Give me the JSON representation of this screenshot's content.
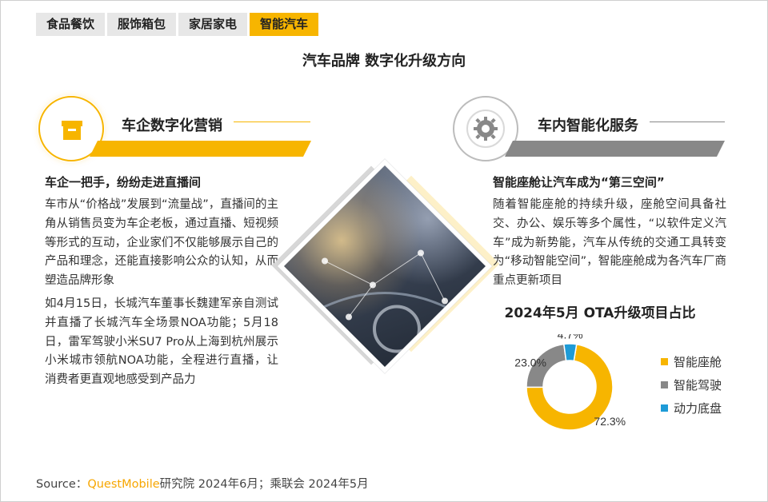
{
  "tabs": [
    {
      "label": "食品餐饮",
      "active": false
    },
    {
      "label": "服饰箱包",
      "active": false
    },
    {
      "label": "家居家电",
      "active": false
    },
    {
      "label": "智能汽车",
      "active": true
    }
  ],
  "page_title": "汽车品牌 数字化升级方向",
  "left_section": {
    "icon": "briefcase-icon",
    "title": "车企数字化营销",
    "subhead": "车企一把手，纷纷走进直播间",
    "para1": "车市从“价格战”发展到“流量战”，直播间的主角从销售员变为车企老板，通过直播、短视频等形式的互动，企业家们不仅能够展示自己的产品和理念，还能直接影响公众的认知，从而塑造品牌形象",
    "para2": "如4月15日，长城汽车董事长魏建军亲自测试并直播了长城汽车全场景NOA功能；5月18日，雷军驾驶小米SU7 Pro从上海到杭州展示小米城市领航NOA功能，全程进行直播，让消费者更直观地感受到产品力"
  },
  "right_section": {
    "icon": "gear-icon",
    "title": "车内智能化服务",
    "subhead": "智能座舱让汽车成为“第三空间”",
    "para": "随着智能座舱的持续升级，座舱空间具备社交、办公、娱乐等多个属性，“以软件定义汽车”成为新势能，汽车从传统的交通工具转变为“移动智能空间”，智能座舱成为各汽车厂商重点更新项目"
  },
  "chart_data": {
    "type": "pie",
    "title": "2024年5月 OTA升级项目占比",
    "donut": true,
    "categories": [
      "智能座舱",
      "智能驾驶",
      "动力底盘"
    ],
    "values": [
      72.3,
      23.0,
      4.7
    ],
    "labels": [
      "72.3%",
      "23.0%",
      "4.7%"
    ],
    "colors": [
      "#F7B500",
      "#888888",
      "#1E9BD7"
    ],
    "legend_position": "right"
  },
  "source": {
    "prefix": "Source：",
    "brand": "QuestMobile",
    "rest": "研究院 2024年6月；乘联会 2024年5月"
  }
}
